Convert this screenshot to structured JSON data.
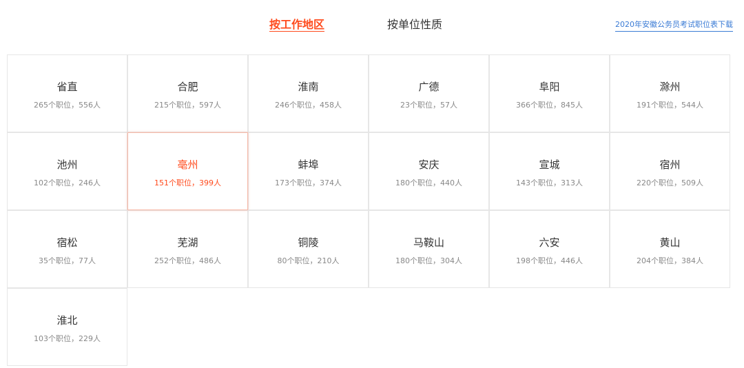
{
  "tabs": {
    "by_region": "按工作地区",
    "by_unit": "按单位性质"
  },
  "download_link": "2020年安徽公务员考试职位表下载",
  "regions": [
    {
      "name": "省直",
      "stats": "265个职位，556人"
    },
    {
      "name": "合肥",
      "stats": "215个职位，597人"
    },
    {
      "name": "淮南",
      "stats": "246个职位，458人"
    },
    {
      "name": "广德",
      "stats": "23个职位，57人"
    },
    {
      "name": "阜阳",
      "stats": "366个职位，845人"
    },
    {
      "name": "滁州",
      "stats": "191个职位，544人"
    },
    {
      "name": "池州",
      "stats": "102个职位，246人"
    },
    {
      "name": "亳州",
      "stats": "151个职位，399人"
    },
    {
      "name": "蚌埠",
      "stats": "173个职位，374人"
    },
    {
      "name": "安庆",
      "stats": "180个职位，440人"
    },
    {
      "name": "宣城",
      "stats": "143个职位，313人"
    },
    {
      "name": "宿州",
      "stats": "220个职位，509人"
    },
    {
      "name": "宿松",
      "stats": "35个职位，77人"
    },
    {
      "name": "芜湖",
      "stats": "252个职位，486人"
    },
    {
      "name": "铜陵",
      "stats": "80个职位，210人"
    },
    {
      "name": "马鞍山",
      "stats": "180个职位，304人"
    },
    {
      "name": "六安",
      "stats": "198个职位，446人"
    },
    {
      "name": "黄山",
      "stats": "204个职位，384人"
    },
    {
      "name": "淮北",
      "stats": "103个职位，229人"
    }
  ],
  "active_region_index": 7,
  "colors": {
    "accent": "#ff4a1c",
    "link": "#3a7bd5",
    "border": "#e6e6e6"
  }
}
